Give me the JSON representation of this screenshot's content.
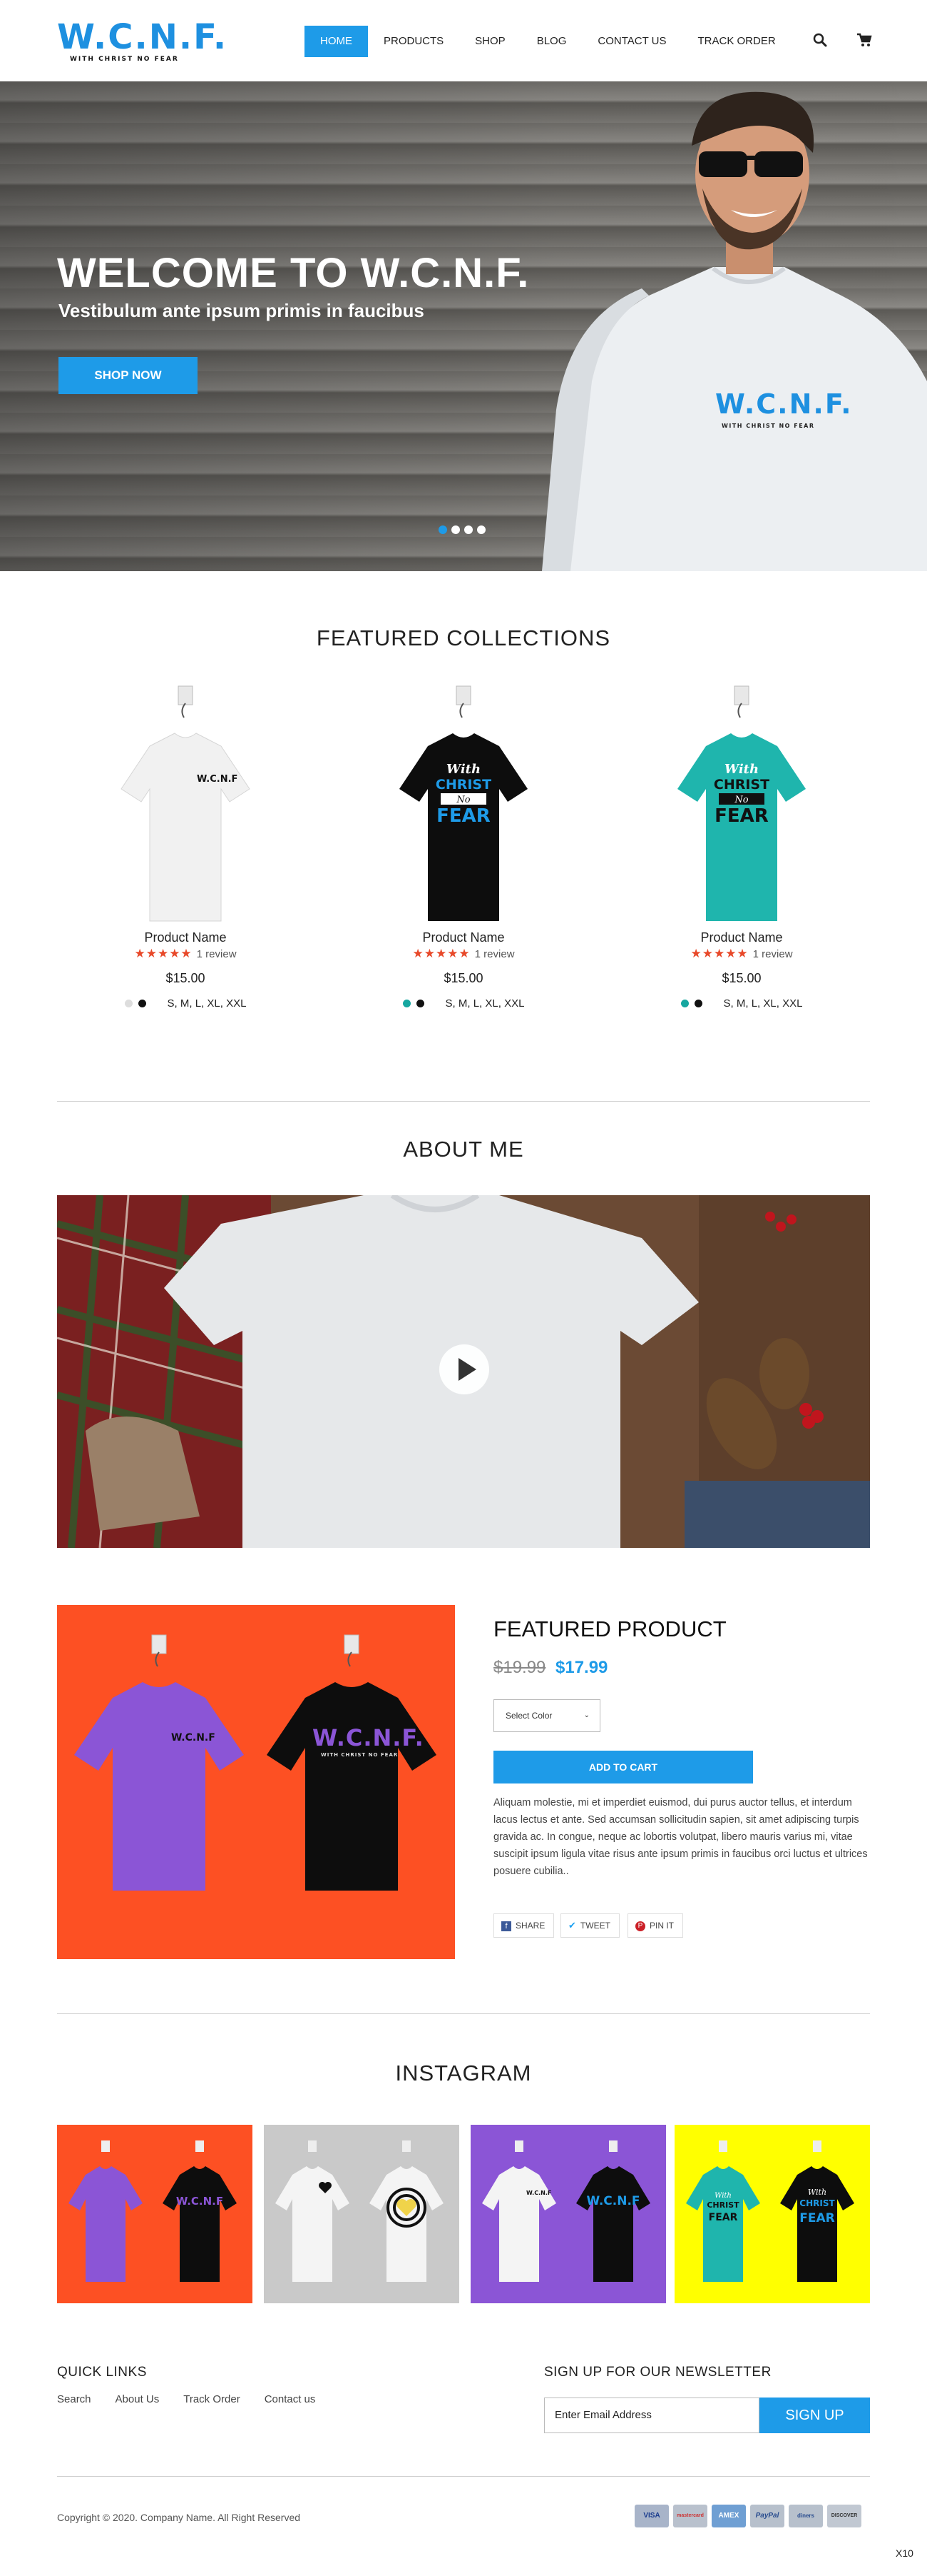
{
  "brand": {
    "logo_main": "W.C.N.F.",
    "logo_sub": "WITH CHRIST NO FEAR",
    "accent": "#1e9be8"
  },
  "nav": {
    "items": [
      "HOME",
      "PRODUCTS",
      "SHOP",
      "BLOG",
      "CONTACT US",
      "TRACK ORDER"
    ],
    "active": "HOME",
    "icons": [
      "search-icon",
      "cart-icon"
    ]
  },
  "hero": {
    "title": "WELCOME TO W.C.N.F.",
    "subtitle": "Vestibulum ante ipsum primis in faucibus",
    "button": "SHOP NOW",
    "shirt_logo": "W.C.N.F.",
    "shirt_sub": "WITH CHRIST NO FEAR",
    "slides": 4,
    "active_slide": 1
  },
  "featured_collections": {
    "title": "FEATURED COLLECTIONS",
    "products": [
      {
        "name": "Product Name",
        "rating": 5,
        "reviews": "1 review",
        "price": "$15.00",
        "sizes": "S,  M,  L,  XL,  XXL",
        "shirt_color": "#f2f2f2",
        "print": "W.C.N.F",
        "swatches": [
          "#dddddd",
          "#111111"
        ]
      },
      {
        "name": "Product Name",
        "rating": 5,
        "reviews": "1 review",
        "price": "$15.00",
        "sizes": "S,  M,  L,  XL,  XXL",
        "shirt_color": "#0d0d0d",
        "print_lines": [
          "With",
          "CHRIST",
          "No",
          "FEAR"
        ],
        "swatches": [
          "#16a7a0",
          "#111111"
        ]
      },
      {
        "name": "Product Name",
        "rating": 5,
        "reviews": "1 review",
        "price": "$15.00",
        "sizes": "S,  M,  L,  XL,  XXL",
        "shirt_color": "#1fb5ad",
        "print_lines": [
          "With",
          "CHRIST",
          "No",
          "FEAR"
        ],
        "swatches": [
          "#16a7a0",
          "#111111"
        ]
      }
    ]
  },
  "about": {
    "title": "ABOUT ME"
  },
  "featured_product": {
    "title": "FEATURED PRODUCT",
    "old_price": "$19.99",
    "new_price": "$17.99",
    "select_placeholder": "Select Color",
    "cart_button": "ADD TO CART",
    "description": "Aliquam molestie, mi et imperdiet euismod, dui purus auctor tellus, et interdum lacus lectus et ante. Sed accumsan sollicitudin sapien, sit amet adipiscing turpis gravida ac. In congue, neque ac lobortis volutpat, libero mauris varius mi, vitae suscipit ipsum ligula vitae risus ante ipsum primis in faucibus orci luctus et ultrices posuere cubilia..",
    "share": [
      "SHARE",
      "TWEET",
      "PIN IT"
    ],
    "shirt_print": "W.C.N.F.",
    "shirt_sub": "WITH CHRIST NO FEAR",
    "background": "#fd5023"
  },
  "instagram": {
    "title": "INSTAGRAM",
    "tiles": [
      {
        "bg": "#fd5023",
        "left": "#8b55d6",
        "right": "#0d0d0d"
      },
      {
        "bg": "#c9c9c9",
        "left": "#f4f4f4",
        "right": "#f4f4f4"
      },
      {
        "bg": "#8b55d6",
        "left": "#f4f4f4",
        "right": "#0d0d0d"
      },
      {
        "bg": "#ffff00",
        "left": "#1fb5ad",
        "right": "#0d0d0d"
      }
    ]
  },
  "footer": {
    "quick_links_title": "QUICK LINKS",
    "links": [
      "Search",
      "About Us",
      "Track Order",
      "Contact us"
    ],
    "newsletter_title": "SIGN UP FOR OUR NEWSLETTER",
    "email_placeholder": "Enter Email Address",
    "signup_button": "SIGN UP",
    "copyright": "Copyright © 2020. Company Name. All Right Reserved",
    "payments": [
      "VISA",
      "mastercard",
      "AMEX",
      "PayPal",
      "diners",
      "DISCOVER"
    ],
    "corner_badge": "X10"
  }
}
